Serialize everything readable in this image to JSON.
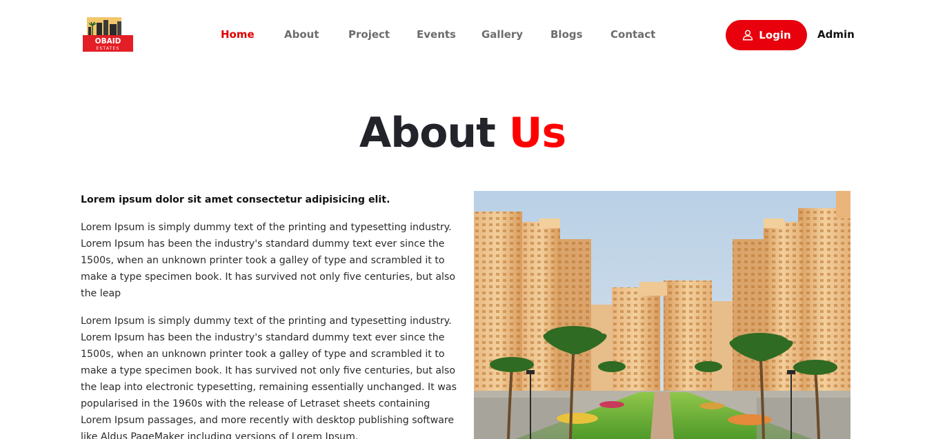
{
  "brand": {
    "logo_line1": "OBAID",
    "logo_line2": "ESTATES"
  },
  "nav": {
    "items": [
      {
        "label": "Home",
        "active": true
      },
      {
        "label": "About",
        "active": false
      },
      {
        "label": "Project",
        "active": false
      },
      {
        "label": "Events",
        "active": false
      },
      {
        "label": "Gallery",
        "active": false
      },
      {
        "label": "Blogs",
        "active": false
      },
      {
        "label": "Contact",
        "active": false
      }
    ],
    "login_label": "Login",
    "login_icon": "user-icon",
    "admin_label": "Admin"
  },
  "about": {
    "title_main": "About",
    "title_accent": "Us",
    "lead": "Lorem ipsum dolor sit amet consectetur adipisicing elit.",
    "paragraph1": "Lorem Ipsum is simply dummy text of the printing and typesetting industry. Lorem Ipsum has been the industry's standard dummy text ever since the 1500s, when an unknown printer took a galley of type and scrambled it to make a type specimen book. It has survived not only five centuries, but also the leap",
    "paragraph2": "Lorem Ipsum is simply dummy text of the printing and typesetting industry. Lorem Ipsum has been the industry's standard dummy text ever since the 1500s, when an unknown printer took a galley of type and scrambled it to make a type specimen book. It has survived not only five centuries, but also the leap into electronic typesetting, remaining essentially unchanged. It was popularised in the 1960s with the release of Letraset sheets containing Lorem Ipsum passages, and more recently with desktop publishing software like Aldus PageMaker including versions of Lorem Ipsum."
  },
  "colors": {
    "accent": "#e8000d",
    "nav_text": "#6c6c6c",
    "title_dark": "#22242a"
  }
}
